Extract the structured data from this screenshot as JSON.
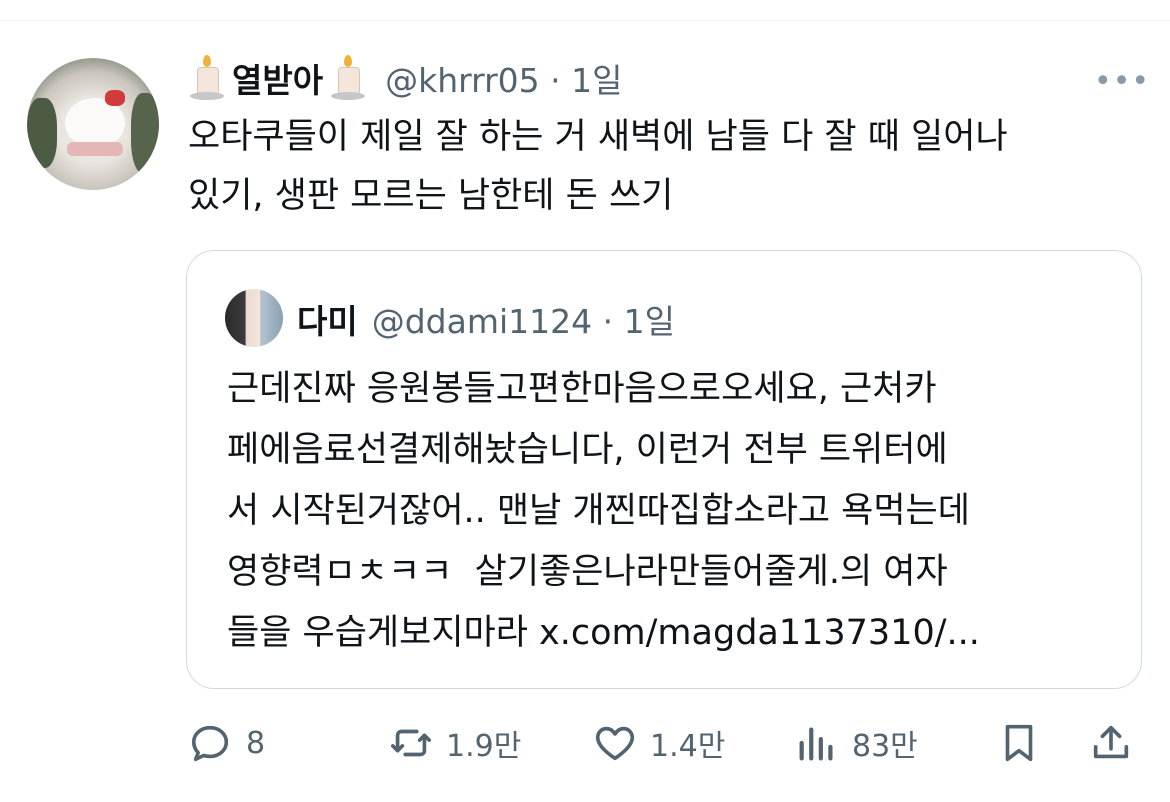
{
  "tweet": {
    "display_name": "열받아",
    "handle_time": "@khrrr05 · 1일",
    "more_label": "•••",
    "text": "오타쿠들이 제일 잘 하는 거 새벽에 남들 다 잘 때 일어나\n있기, 생판 모르는 남한테 돈 쓰기"
  },
  "quote": {
    "display_name": "다미",
    "handle_time": "@ddami1124 · 1일",
    "text": "근데진짜 응원봉들고편한마음으로오세요, 근처카\n페에음료선결제해놨습니다, 이런거 전부 트위터에\n서 시작된거잖어.. 맨날 개찐따집합소라고 욕먹는데\n영향력ㅁㅊㅋㅋ  살기좋은나라만들어줄게.의 여자\n들을 우습게보지마라 x.com/magda1137310/..."
  },
  "actions": {
    "reply_count": "8",
    "retweet_count": "1.9만",
    "like_count": "1.4만",
    "views_count": "83만"
  },
  "icons": {
    "reply": "reply-icon",
    "retweet": "retweet-icon",
    "like": "heart-icon",
    "views": "views-icon",
    "bookmark": "bookmark-icon",
    "share": "share-icon"
  },
  "colors": {
    "text": "#0f1419",
    "secondary": "#536471",
    "border": "#cfd9de"
  }
}
